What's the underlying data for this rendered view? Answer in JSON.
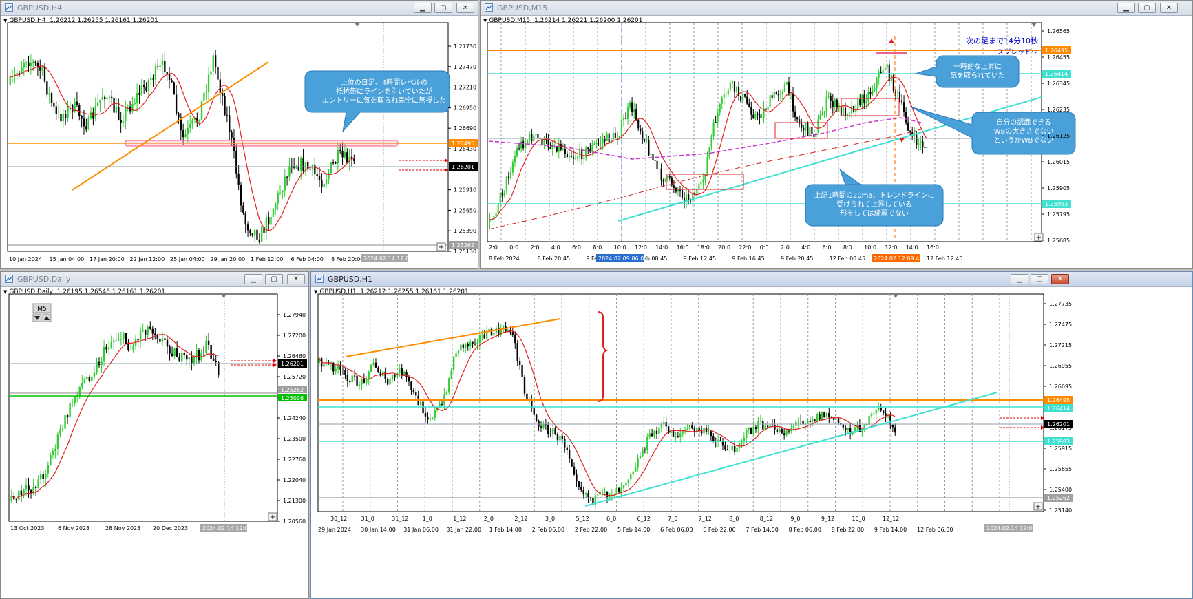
{
  "windows": {
    "h4": {
      "title": "GBPUSD,H4",
      "info_symbol": "GBPUSD,H4",
      "info_prices": "1.26212 1.26255 1.26161 1.26201",
      "y_ticks": [
        "1.27730",
        "1.27470",
        "1.27210",
        "1.26950",
        "1.26690",
        "1.26430",
        "1.26170",
        "1.25910",
        "1.25650",
        "1.25390",
        "1.25130"
      ],
      "x_ticks": [
        "10 Jan 2024",
        "15 Jan 04:00",
        "17 Jan 20:00",
        "22 Jan 12:00",
        "25 Jan 04:00",
        "29 Jan 20:00",
        "1 Feb 12:00",
        "6 Feb 04:00",
        "8 Feb 20:00"
      ],
      "cursor_time": "2024.02.14 12:00",
      "price_labels": {
        "orange": "1.26495",
        "current": "1.26201",
        "gray": "1.25262"
      },
      "callout": {
        "line1": "上位の日足、4時間レベルの",
        "line2": "抵抗帯にラインを引いていたが",
        "line3": "エントリーに気を取られ完全に無視した"
      }
    },
    "m15": {
      "title": "GBPUSD,M15",
      "info_symbol": "GBPUSD,M15",
      "info_prices": "1.26214 1.26221 1.26200 1.26201",
      "countdown": "次の足まで14分10秒",
      "spread": "スプレッド:2",
      "y_ticks": [
        "1.26565",
        "1.26455",
        "1.26345",
        "1.26235",
        "1.26125",
        "1.26015",
        "1.25905",
        "1.25795",
        "1.25685"
      ],
      "hour_labels": [
        "2:0",
        "0:0",
        "2:0",
        "4:0",
        "6:0",
        "8:0",
        "10:0",
        "12:0",
        "14:0",
        "16:0",
        "18:0",
        "20:0",
        "22:0",
        "0:0",
        "2:0",
        "4:0",
        "6:0",
        "8:0",
        "10:0",
        "12:0",
        "14:0",
        "16:0"
      ],
      "x_ticks": [
        "8 Feb 2024",
        "8 Feb 20:45",
        "9 Feb 00:4",
        "9 Feb 08:45",
        "9 Feb 12:45",
        "9 Feb 16:45",
        "9 Feb 20:45",
        "12 Feb 00:45",
        "12 Feb 04",
        "12 Feb 12:45"
      ],
      "time_marker_blue": "2024.02.09 06:00",
      "time_marker_red": "2024.02.12 09:45",
      "price_labels": {
        "orange": "1.26495",
        "cyan_top": "1.26414",
        "cyan_bottom": "1.25983"
      },
      "callout_top": {
        "line1": "一時的な上昇に",
        "line2": "気を取られていた"
      },
      "callout_right": {
        "line1": "自分の認識できる",
        "line2": "WBの大きさでない",
        "line3": "というかWBでない"
      },
      "callout_bottom": {
        "line1": "上記1時間の20ma、トレンドラインに",
        "line2": "受けられて上昇している",
        "line3": "形をしては綺麗でない"
      }
    },
    "d1": {
      "title": "GBPUSD,Daily",
      "info_symbol": "GBPUSD,Daily",
      "info_prices": "1.26195 1.26546 1.26161 1.26201",
      "period_button": "M5",
      "y_ticks": [
        "1.27940",
        "1.27200",
        "1.26460",
        "1.25720",
        "1.24980",
        "1.24240",
        "1.23500",
        "1.22760",
        "1.22040",
        "1.21300",
        "1.20560"
      ],
      "x_ticks": [
        "13 Oct 2023",
        "6 Nov 2023",
        "28 Nov 2023",
        "20 Dec 2023",
        "15 Jan 2024"
      ],
      "cursor_time": "2024.02.14 12:00",
      "price_labels": {
        "current": "1.26201",
        "gray": "1.25262",
        "green": "1.25026"
      }
    },
    "h1": {
      "title": "GBPUSD,H1",
      "info_symbol": "GBPUSD,H1",
      "info_prices": "1.26212 1.26255 1.26161 1.26201",
      "y_ticks": [
        "1.27735",
        "1.27475",
        "1.27215",
        "1.26955",
        "1.26695",
        "1.26435",
        "1.26175",
        "1.25915",
        "1.25655",
        "1.25400",
        "1.25140"
      ],
      "day_labels": [
        "30_12",
        "31_0",
        "31_12",
        "1_0",
        "1_12",
        "2_0",
        "2_12",
        "3_0",
        "5_12",
        "6_0",
        "6_12",
        "7_0",
        "7_12",
        "8_0",
        "8_12",
        "9_0",
        "9_12",
        "10_0",
        "12_12"
      ],
      "x_ticks": [
        "29 Jan 2024",
        "30 Jan 14:00",
        "31 Jan 06:00",
        "31 Jan 22:00",
        "1 Feb 14:00",
        "2 Feb 06:00",
        "2 Feb 22:00",
        "5 Feb 14:00",
        "6 Feb 06:00",
        "6 Feb 22:00",
        "7 Feb 14:00",
        "8 Feb 06:00",
        "8 Feb 22:00",
        "9 Feb 14:00",
        "12 Feb 06:00"
      ],
      "cursor_time": "2024.02.14 12:00",
      "price_labels": {
        "orange": "1.26495",
        "cyan_top": "1.26414",
        "current": "1.26201",
        "cyan_bottom": "1.25983",
        "gray": "1.25262"
      }
    }
  },
  "colors": {
    "bull": "#32cd32",
    "bear": "#000000",
    "ma20": "#e02020",
    "orange_line": "#ff8c00",
    "cyan_line": "#40e0d0",
    "callout_fill": "#4aa0d8",
    "current_bg": "#000000"
  }
}
